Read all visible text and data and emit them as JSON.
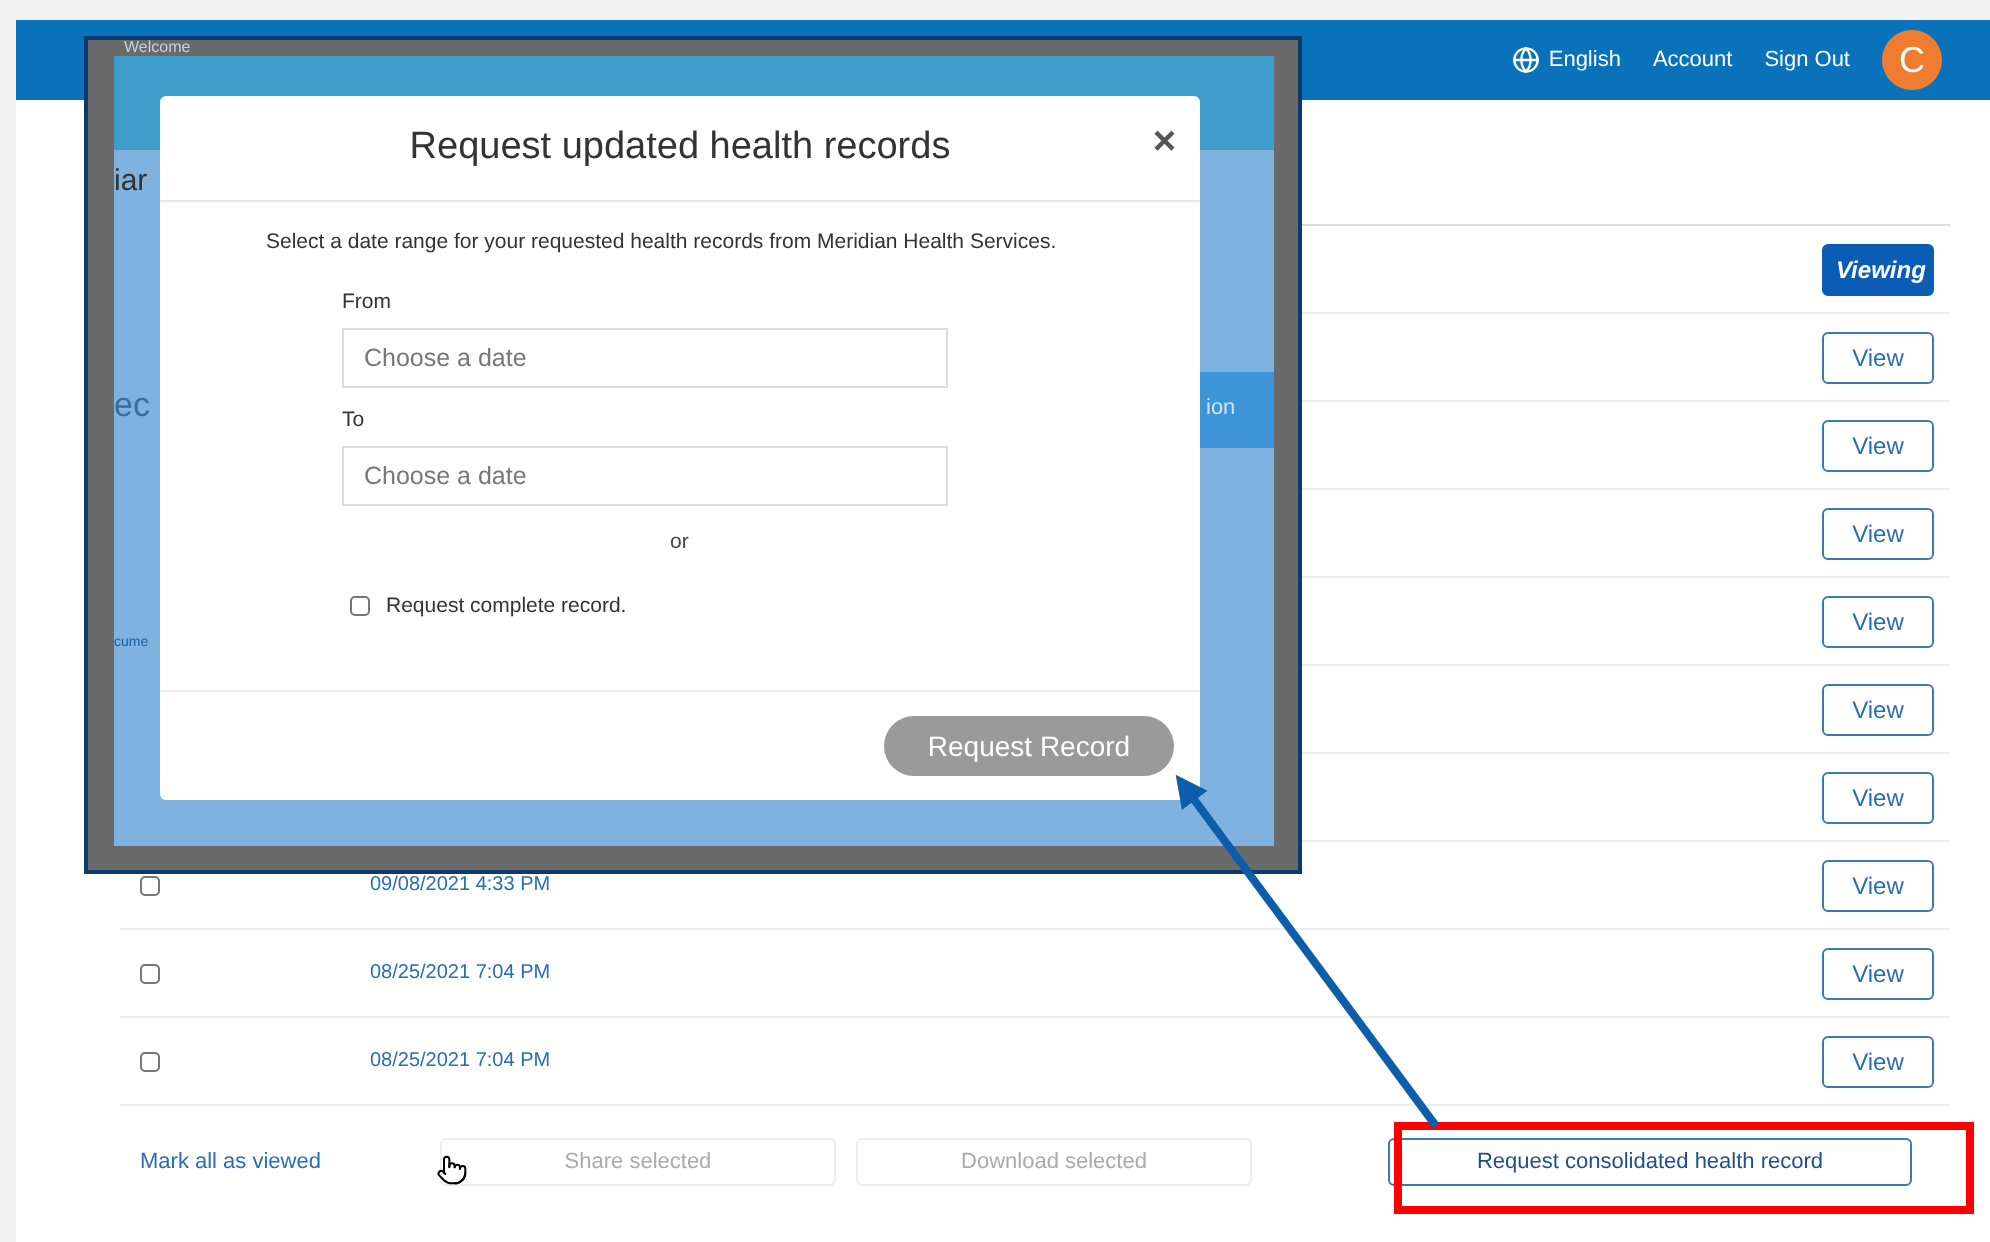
{
  "header": {
    "welcome": "Welcome",
    "language": "English",
    "links": [
      "Account",
      "Sign Out"
    ],
    "avatar": "C"
  },
  "rows": [
    {
      "button": "Viewing",
      "selected": true
    },
    {
      "button": "View",
      "selected": false
    },
    {
      "button": "View",
      "selected": false
    },
    {
      "button": "View",
      "selected": false
    },
    {
      "button": "View",
      "selected": false
    },
    {
      "button": "View",
      "selected": false
    },
    {
      "button": "View",
      "selected": false
    },
    {
      "checked": false,
      "date": "09/08/2021 4:33 PM",
      "button": "View",
      "selected": false
    },
    {
      "checked": false,
      "date": "08/25/2021 7:04 PM",
      "button": "View",
      "selected": false
    },
    {
      "checked": false,
      "date": "08/25/2021 7:04 PM",
      "button": "View",
      "selected": false
    }
  ],
  "footer": {
    "mark_all": "Mark all as viewed",
    "share": {
      "label": "Share selected",
      "disabled": true
    },
    "download": {
      "label": "Download selected",
      "disabled": true
    },
    "request": "Request consolidated health record"
  },
  "inset": {
    "fragments": [
      "iar",
      "ec",
      "cume",
      "ion"
    ],
    "modal": {
      "title": "Request updated health records",
      "close": "×",
      "intro": "Select a date range for your requested health records from Meridian Health Services.",
      "from_label": "From",
      "from_placeholder": "Choose a date",
      "to_label": "To",
      "to_placeholder": "Choose a date",
      "or": "or",
      "complete": {
        "label": "Request complete record.",
        "checked": false
      },
      "submit": {
        "label": "Request Record",
        "disabled": true
      }
    }
  }
}
